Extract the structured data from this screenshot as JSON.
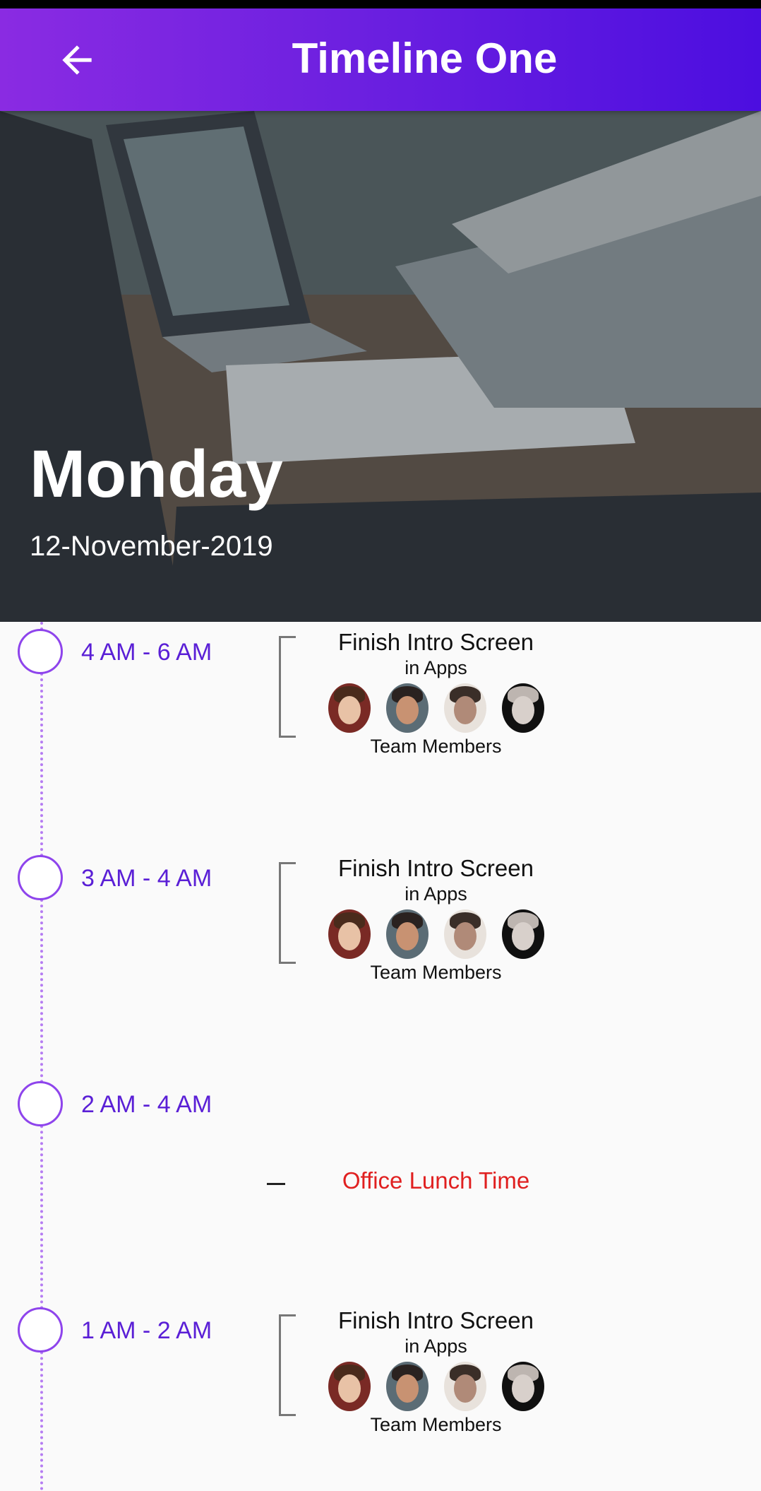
{
  "app_bar": {
    "title": "Timeline One",
    "back_icon": "arrow-back-icon"
  },
  "hero": {
    "day": "Monday",
    "date": "12-November-2019"
  },
  "timeline": [
    {
      "time": "4 AM - 6 AM",
      "type": "task",
      "title": "Finish Intro Screen",
      "subtitle": "in Apps",
      "footer": "Team Members"
    },
    {
      "time": "3 AM - 4 AM",
      "type": "task",
      "title": "Finish Intro Screen",
      "subtitle": "in Apps",
      "footer": "Team Members"
    },
    {
      "time": "2 AM - 4 AM",
      "type": "break",
      "title": "Office Lunch Time"
    },
    {
      "time": "1 AM - 2 AM",
      "type": "task",
      "title": "Finish Intro Screen",
      "subtitle": "in Apps",
      "footer": "Team Members"
    }
  ],
  "colors": {
    "accent": "#6a1fe0",
    "time_text": "#5a1fd6",
    "lunch_text": "#e02020",
    "line": "#b57cf2"
  }
}
